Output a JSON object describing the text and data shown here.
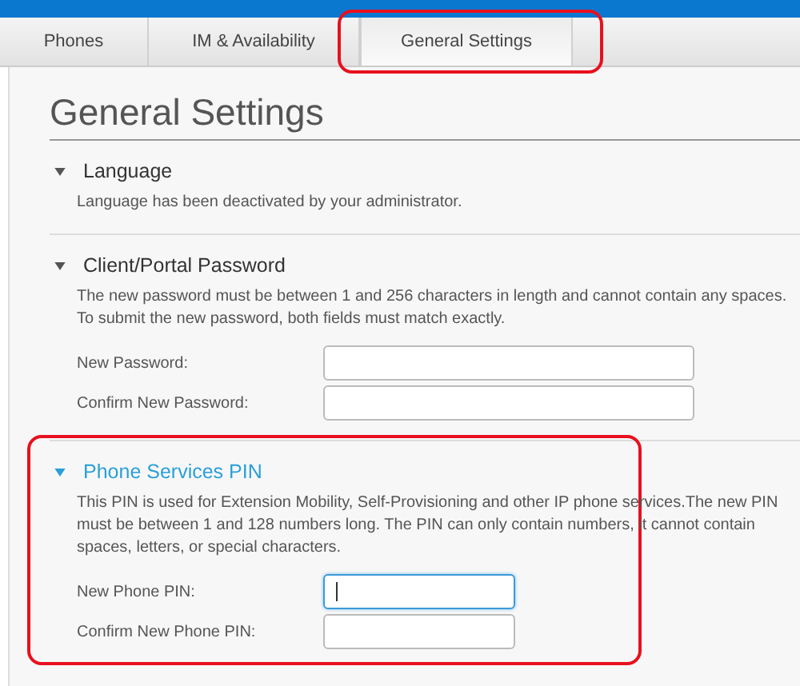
{
  "tabs": [
    {
      "label": "Phones",
      "selected": false
    },
    {
      "label": "IM & Availability",
      "selected": false
    },
    {
      "label": "General Settings",
      "selected": true
    }
  ],
  "title": "General Settings",
  "sections": [
    {
      "heading": "Language",
      "expanded": true,
      "highlighted": false,
      "description": "Language has been deactivated by your administrator."
    },
    {
      "heading": "Client/Portal Password",
      "expanded": true,
      "highlighted": false,
      "description": "The new password must be between 1 and 256 characters in length and cannot contain any spaces. To submit the new password, both fields must match exactly.",
      "fields": [
        {
          "label": "New Password:",
          "focused": false
        },
        {
          "label": "Confirm New Password:",
          "focused": false
        }
      ]
    },
    {
      "heading": "Phone Services PIN",
      "expanded": true,
      "highlighted": true,
      "description": "This PIN is used for Extension Mobility, Self-Provisioning and other IP phone services.The new PIN must be between 1 and 128 numbers long. The PIN can only contain numbers, it cannot contain spaces, letters, or special characters.",
      "fields": [
        {
          "label": "New Phone PIN:",
          "focused": true
        },
        {
          "label": "Confirm New Phone PIN:",
          "focused": false
        }
      ]
    }
  ]
}
